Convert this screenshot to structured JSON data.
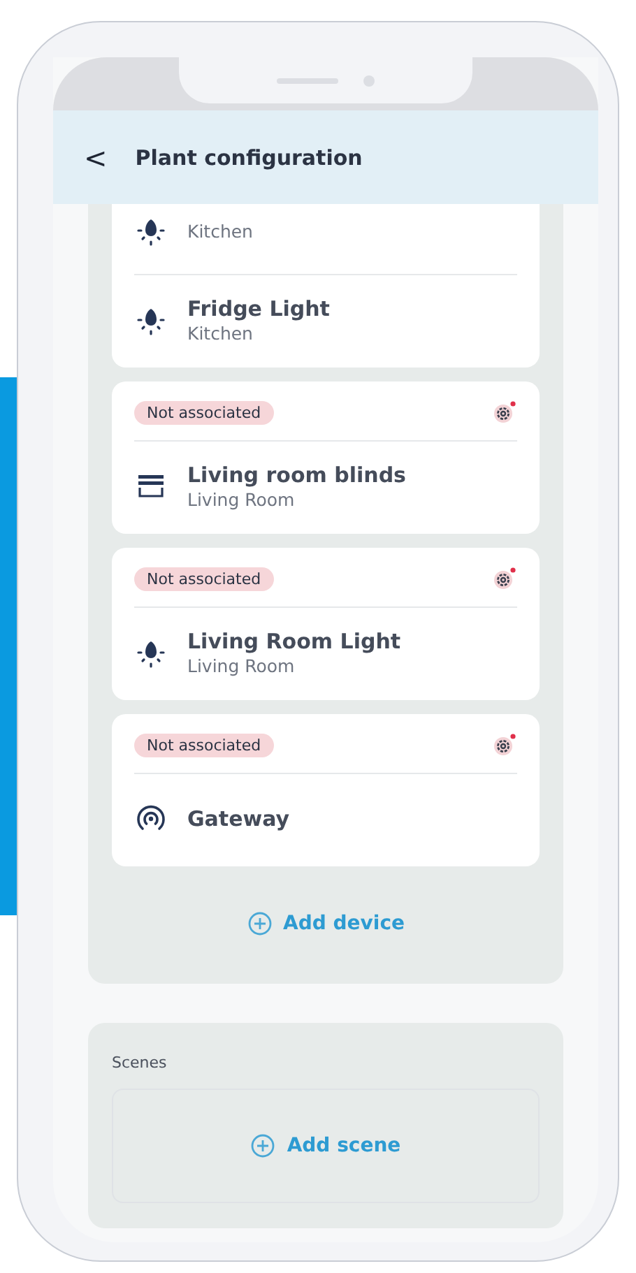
{
  "header": {
    "back": "<",
    "title": "Plant configuration"
  },
  "devices": [
    {
      "associated": true,
      "items": [
        {
          "kind": "light",
          "location": "Kitchen"
        },
        {
          "kind": "light",
          "name": "Fridge Light",
          "location": "Kitchen"
        }
      ]
    },
    {
      "associated": false,
      "badge": "Not associated",
      "items": [
        {
          "kind": "blinds",
          "name": "Living room blinds",
          "location": "Living Room"
        }
      ]
    },
    {
      "associated": false,
      "badge": "Not associated",
      "items": [
        {
          "kind": "light",
          "name": "Living Room Light",
          "location": "Living Room"
        }
      ]
    },
    {
      "associated": false,
      "badge": "Not associated",
      "items": [
        {
          "kind": "gateway",
          "name": "Gateway"
        }
      ]
    }
  ],
  "add_device": "Add device",
  "scenes": {
    "label": "Scenes",
    "add": "Add scene"
  }
}
